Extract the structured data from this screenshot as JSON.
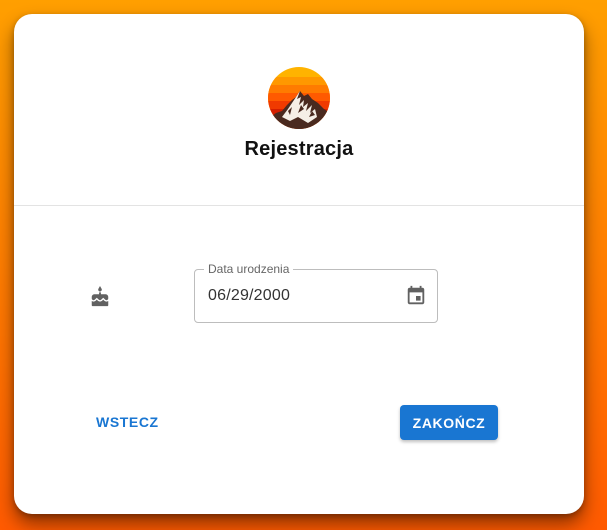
{
  "colors": {
    "background_top": "#ff9f00",
    "background_bottom": "#ff5a00",
    "primary": "#1976d2",
    "card": "#ffffff"
  },
  "header": {
    "logo_icon": "sunset-mountain-logo",
    "title": "Rejestracja"
  },
  "form": {
    "field_icon": "birthday-cake-icon",
    "birth_date": {
      "label": "Data urodzenia",
      "value": "06/29/2000",
      "icon": "calendar-icon"
    }
  },
  "actions": {
    "back_label": "WSTECZ",
    "finish_label": "ZAKOŃCZ"
  }
}
